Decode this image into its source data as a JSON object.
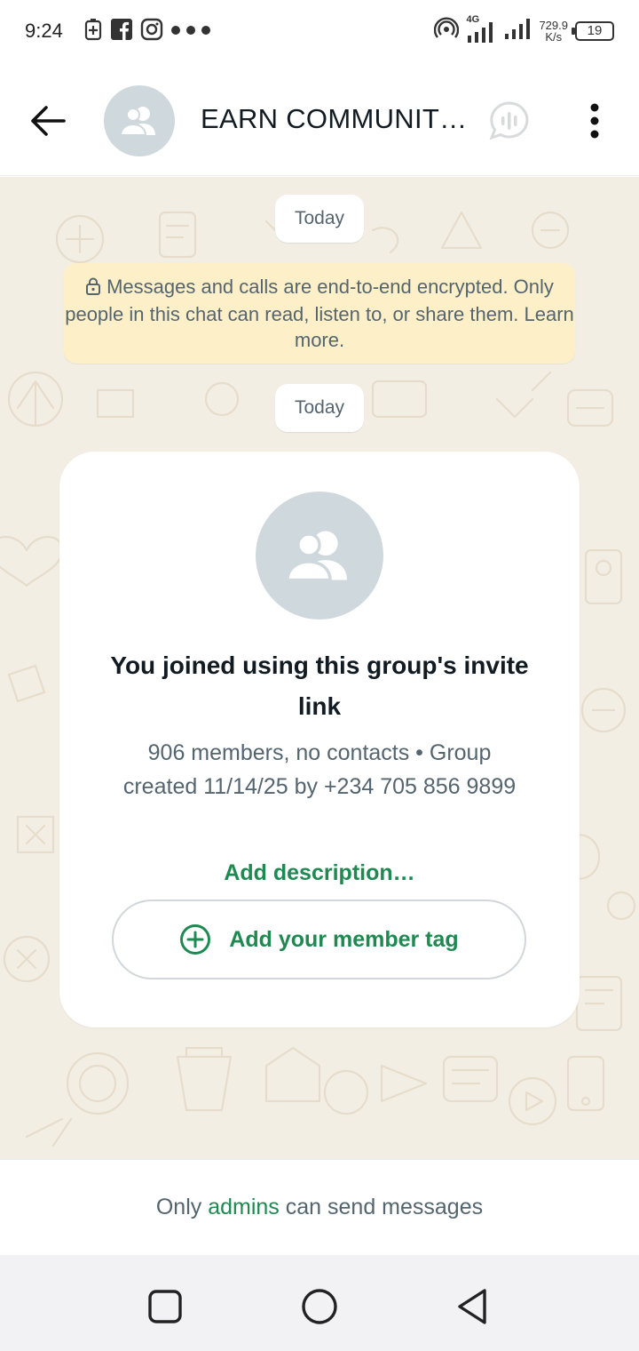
{
  "status_bar": {
    "time": "9:24",
    "network": "4G",
    "speed_value": "729.9",
    "speed_unit": "K/s",
    "battery": "19"
  },
  "header": {
    "title": "EARN COMMUNIT…",
    "icons": [
      "back-arrow-icon",
      "group-avatar-icon",
      "voice-chat-icon",
      "more-options-icon"
    ]
  },
  "chat": {
    "date_chip_1": "Today",
    "encryption_notice": "Messages and calls are end-to-end encrypted. Only people in this chat can read, listen to, or share them. Learn more.",
    "date_chip_2": "Today",
    "group_card": {
      "title": "You joined using this group's invite link",
      "meta": "906 members, no contacts • Group created 11/14/25 by +234 705 856 9899",
      "add_description": "Add description…",
      "member_tag_button": "Add your member tag"
    }
  },
  "footer": {
    "prefix": "Only",
    "link": "admins",
    "suffix": "can send messages"
  },
  "colors": {
    "accent_green": "#1e8a52",
    "chat_background": "#f3eee4",
    "encryption_background": "#fdf0c8",
    "avatar_grey": "#cfd8dc"
  }
}
